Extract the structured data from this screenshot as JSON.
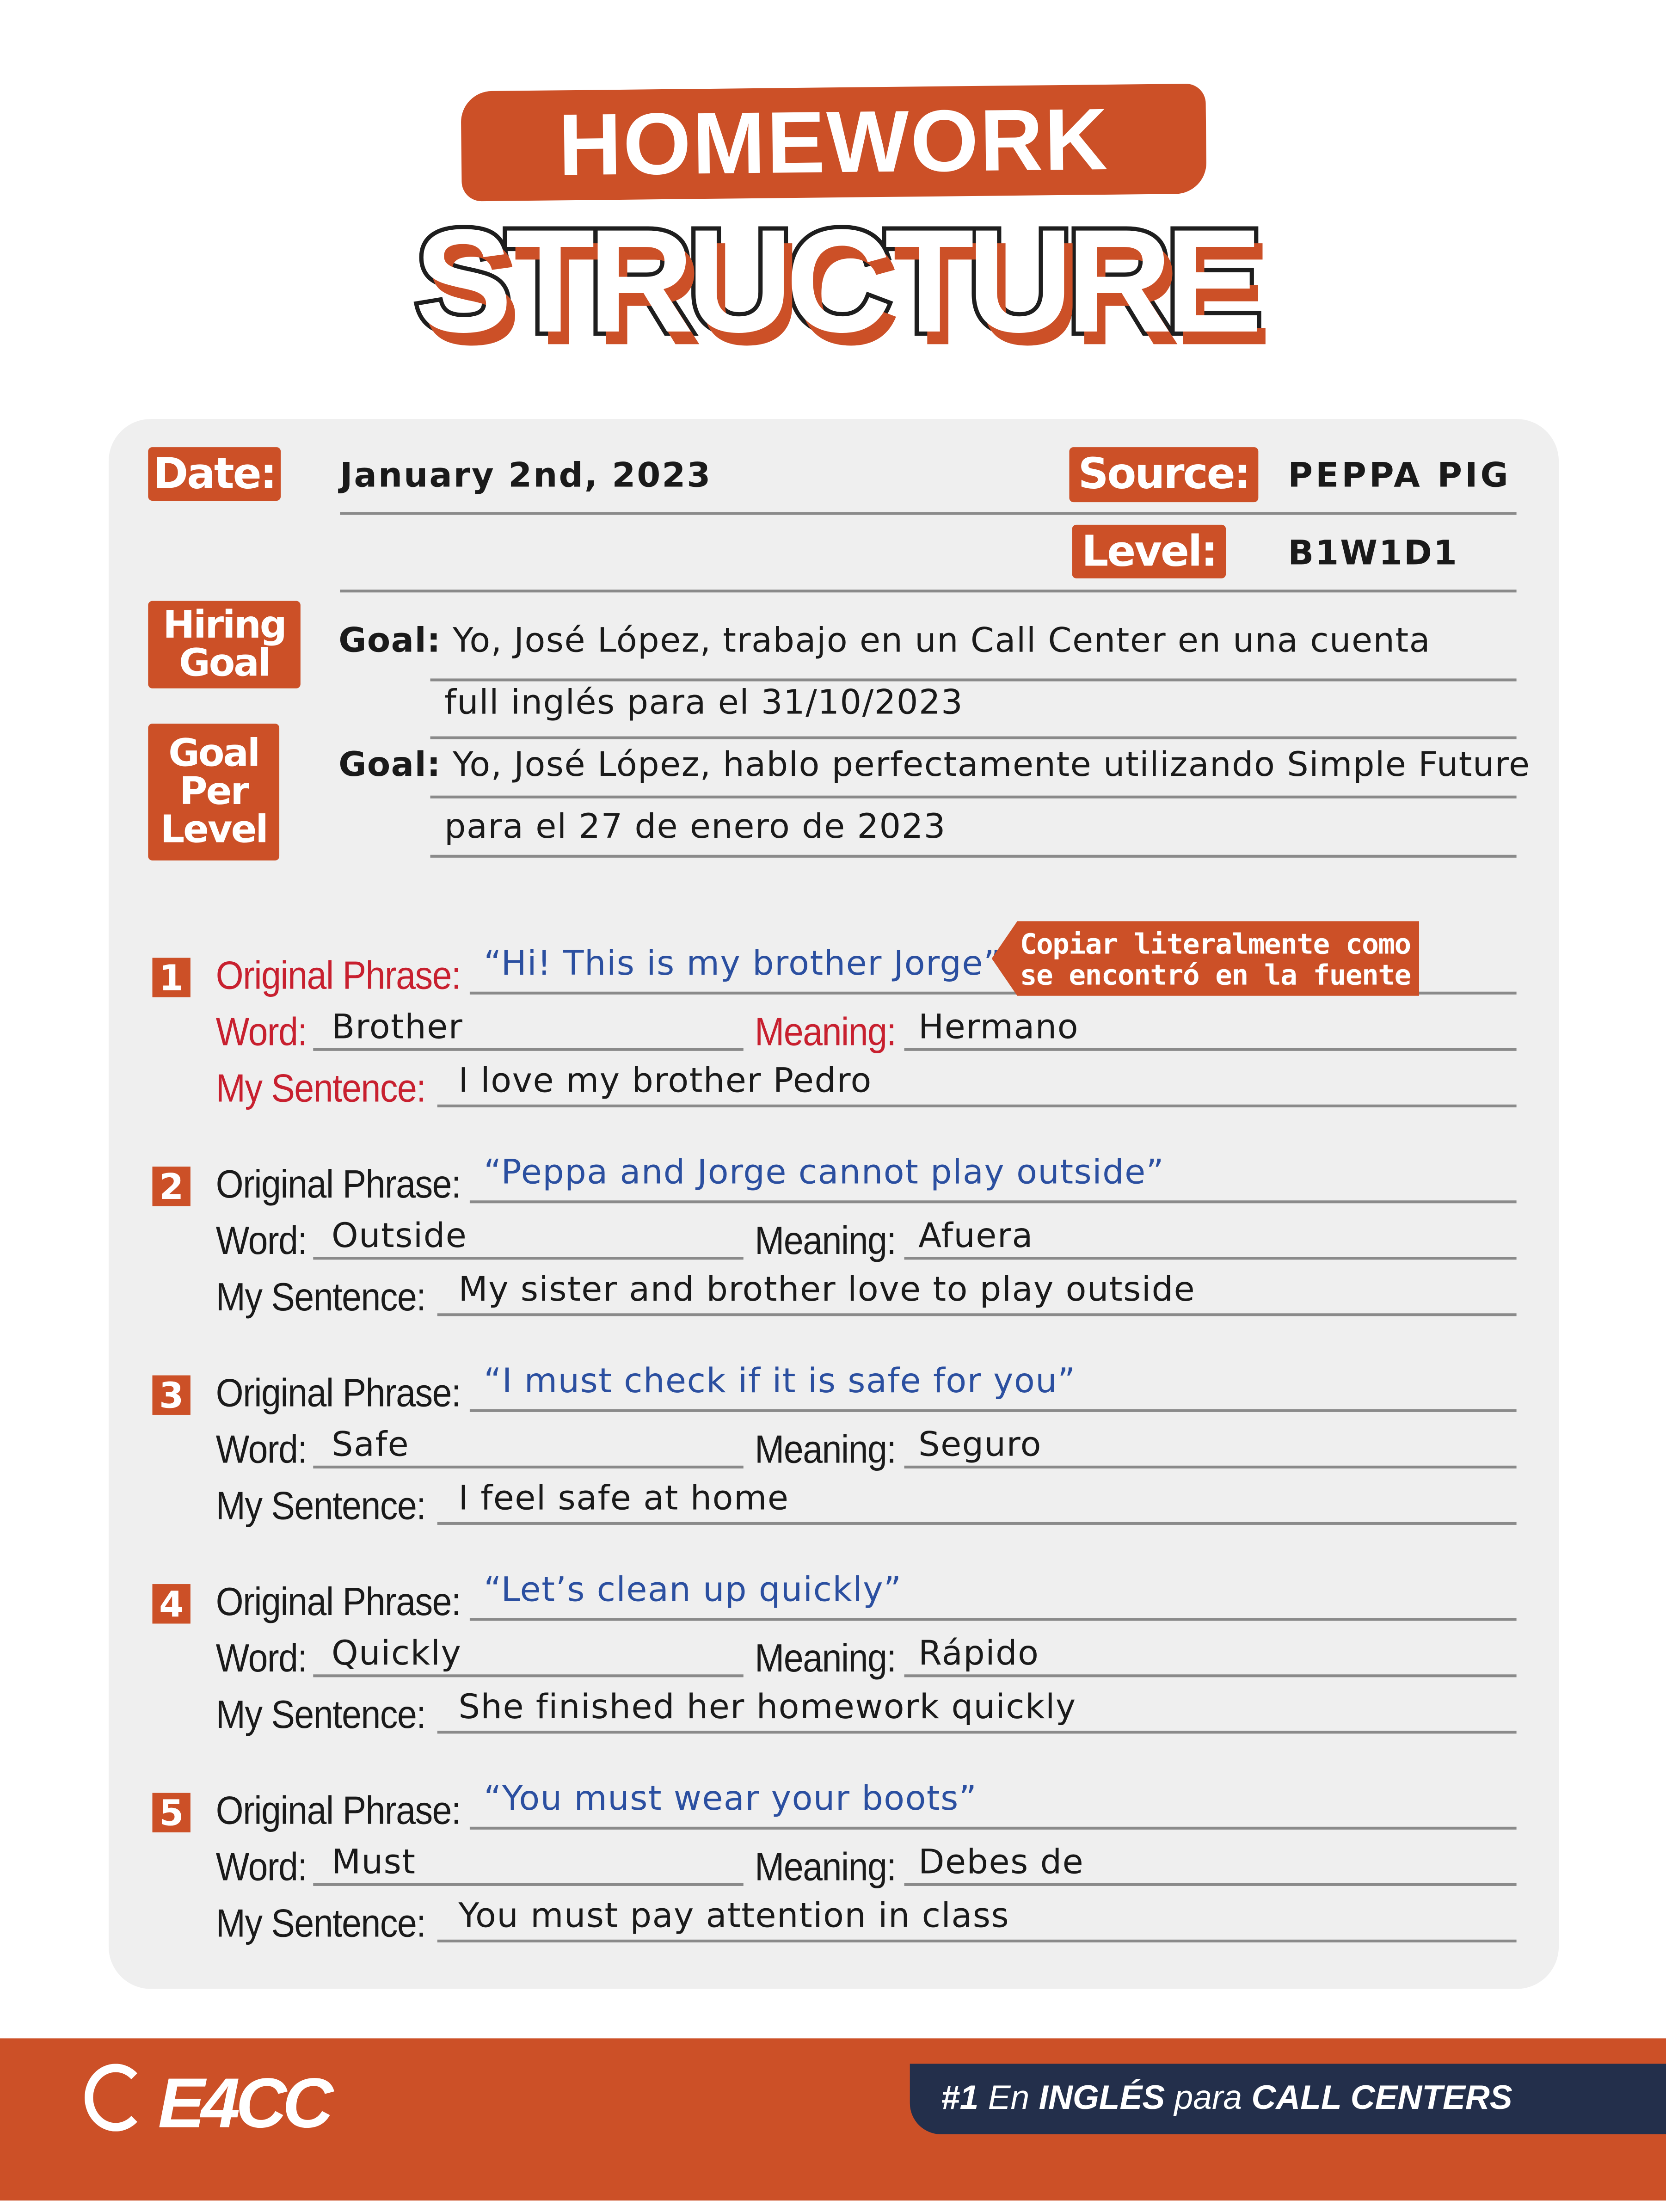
{
  "header": {
    "title_top": "HOMEWORK",
    "title_bottom": "STRUCTURE"
  },
  "info": {
    "date_label": "Date:",
    "date_value": "January 2nd, 2023",
    "source_label": "Source:",
    "source_value": "PEPPA PIG",
    "level_label": "Level:",
    "level_value": "B1W1D1"
  },
  "goals": {
    "hiring_goal_label": [
      "Hiring",
      "Goal"
    ],
    "goal_per_level_label": [
      "Goal",
      "Per",
      "Level"
    ],
    "goal_prefix": "Goal:",
    "hiring_goal_line1": "Yo, José López, trabajo en un Call Center en una cuenta",
    "hiring_goal_line2": "full inglés para el 31/10/2023",
    "level_goal_line1": "Yo, José López, hablo perfectamente utilizando Simple Future",
    "level_goal_line2": "para el 27 de enero de 2023"
  },
  "labels": {
    "original_phrase": "Original Phrase:",
    "word": "Word:",
    "meaning": "Meaning:",
    "my_sentence": "My Sentence:"
  },
  "callout": {
    "line1": "Copiar literalmente como",
    "line2": "se encontró en la fuente"
  },
  "items": [
    {
      "number": "1",
      "phrase": "“Hi! This is my brother Jorge”",
      "word": "Brother",
      "meaning": "Hermano",
      "sentence": "I love my brother Pedro"
    },
    {
      "number": "2",
      "phrase": "“Peppa and Jorge cannot play outside”",
      "word": "Outside",
      "meaning": "Afuera",
      "sentence": "My sister and brother love to play outside"
    },
    {
      "number": "3",
      "phrase": "“I must check if it is safe for you”",
      "word": "Safe",
      "meaning": "Seguro",
      "sentence": "I feel safe at home"
    },
    {
      "number": "4",
      "phrase": "“Let’s clean up quickly”",
      "word": "Quickly",
      "meaning": "Rápido",
      "sentence": "She finished her homework quickly"
    },
    {
      "number": "5",
      "phrase": "“You must wear your boots”",
      "word": "Must",
      "meaning": "Debes de",
      "sentence": "You must pay attention in class"
    }
  ],
  "footer": {
    "logo": "E4CC",
    "tagline": {
      "rank": "#1",
      "en": "En",
      "ingles": "INGLÉS",
      "para": "para",
      "call_centers": "CALL CENTERS"
    }
  },
  "colors": {
    "accent": "#cc5027",
    "phrase_blue": "#2b4fa0",
    "highlight_red": "#c8202f",
    "navy": "#232f4b",
    "panel": "#efefef"
  }
}
